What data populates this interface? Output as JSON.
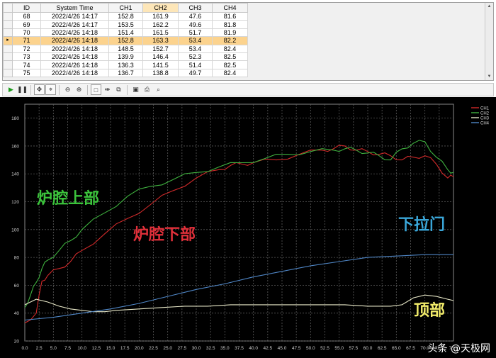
{
  "grid": {
    "columns": [
      "ID",
      "System Time",
      "CH1",
      "CH2",
      "CH3",
      "CH4"
    ],
    "active_column": "CH2",
    "rows": [
      {
        "id": "68",
        "time": "2022/4/26 14:17",
        "ch1": "152.8",
        "ch2": "161.9",
        "ch3": "47.6",
        "ch4": "81.6",
        "selected": false
      },
      {
        "id": "69",
        "time": "2022/4/26 14:17",
        "ch1": "153.5",
        "ch2": "162.2",
        "ch3": "49.6",
        "ch4": "81.8",
        "selected": false
      },
      {
        "id": "70",
        "time": "2022/4/26 14:18",
        "ch1": "151.4",
        "ch2": "161.5",
        "ch3": "51.7",
        "ch4": "81.9",
        "selected": false
      },
      {
        "id": "71",
        "time": "2022/4/26 14:18",
        "ch1": "152.8",
        "ch2": "163.3",
        "ch3": "53.4",
        "ch4": "82.2",
        "selected": true
      },
      {
        "id": "72",
        "time": "2022/4/26 14:18",
        "ch1": "148.5",
        "ch2": "152.7",
        "ch3": "53.4",
        "ch4": "82.4",
        "selected": false
      },
      {
        "id": "73",
        "time": "2022/4/26 14:18",
        "ch1": "139.9",
        "ch2": "146.4",
        "ch3": "52.3",
        "ch4": "82.5",
        "selected": false
      },
      {
        "id": "74",
        "time": "2022/4/26 14:18",
        "ch1": "136.3",
        "ch2": "141.5",
        "ch3": "51.4",
        "ch4": "82.5",
        "selected": false
      },
      {
        "id": "75",
        "time": "2022/4/26 14:18",
        "ch1": "136.7",
        "ch2": "138.8",
        "ch3": "49.7",
        "ch4": "82.4",
        "selected": false
      }
    ]
  },
  "toolbar": {
    "buttons": [
      {
        "name": "play-icon",
        "glyph": "▶"
      },
      {
        "name": "pause-icon",
        "glyph": "❚❚"
      },
      {
        "name": "pan-icon",
        "glyph": "✥"
      },
      {
        "name": "crosshair-zoom-icon",
        "glyph": "⌖"
      },
      {
        "name": "zoom-out-icon",
        "glyph": "⊖"
      },
      {
        "name": "zoom-in-icon",
        "glyph": "⊕"
      },
      {
        "name": "select-rect-icon",
        "glyph": "□"
      },
      {
        "name": "fit-icon",
        "glyph": "⇹"
      },
      {
        "name": "copy-icon",
        "glyph": "⧉"
      },
      {
        "name": "save-icon",
        "glyph": "▣"
      },
      {
        "name": "print-icon",
        "glyph": "⎙"
      },
      {
        "name": "preview-icon",
        "glyph": "⌕"
      }
    ]
  },
  "colors": {
    "ch1": "#d02a2a",
    "ch2": "#3fb13f",
    "ch3": "#e8e8c8",
    "ch4": "#4f86c6",
    "label_upper": "#3cc43c",
    "label_lower": "#e0303a",
    "label_door": "#3aa6d8",
    "label_top": "#f2ec6a"
  },
  "annotations": {
    "upper": "炉腔上部",
    "lower": "炉腔下部",
    "door": "下拉门",
    "top": "顶部"
  },
  "watermark": "头条 @天极网",
  "chart_data": {
    "type": "line",
    "xlim": [
      0,
      75
    ],
    "ylim": [
      20,
      190
    ],
    "x_ticks": [
      "0.0",
      "2.5",
      "5.0",
      "7.5",
      "10.0",
      "12.5",
      "15.0",
      "17.5",
      "20.0",
      "22.5",
      "25.0",
      "27.5",
      "30.0",
      "32.5",
      "35.0",
      "37.5",
      "40.0",
      "42.5",
      "45.0",
      "47.5",
      "50.0",
      "52.5",
      "55.0",
      "57.5",
      "60.0",
      "62.5",
      "65.0",
      "67.5",
      "70.0",
      "72.5",
      "75.0"
    ],
    "y_ticks": [
      "20",
      "40",
      "60",
      "80",
      "100",
      "120",
      "140",
      "160",
      "180"
    ],
    "grid": true,
    "legend_position": "top-right",
    "series": [
      {
        "name": "CH1",
        "x": [
          0,
          2,
          3,
          4,
          6,
          8,
          10,
          14,
          18,
          22,
          26,
          30,
          34,
          36,
          38,
          40,
          44,
          48,
          52,
          54,
          56,
          58,
          60,
          62,
          64,
          66,
          68,
          70,
          72,
          74,
          75
        ],
        "y": [
          33,
          40,
          63,
          67,
          72,
          77,
          85,
          97,
          108,
          118,
          128,
          137,
          143,
          146,
          147,
          148,
          150,
          154,
          157,
          158,
          160,
          157,
          156,
          154,
          153,
          150,
          152,
          153,
          147,
          137,
          138
        ]
      },
      {
        "name": "CH2",
        "x": [
          0,
          1,
          2,
          3,
          4,
          6,
          8,
          10,
          14,
          18,
          22,
          26,
          30,
          34,
          38,
          42,
          46,
          50,
          54,
          56,
          58,
          60,
          62,
          64,
          66,
          68,
          70,
          72,
          74,
          75
        ],
        "y": [
          44,
          53,
          62,
          72,
          78,
          85,
          92,
          100,
          112,
          124,
          131,
          136,
          141,
          145,
          148,
          151,
          154,
          156,
          157,
          158,
          157,
          155,
          153,
          150,
          158,
          162,
          163,
          152,
          143,
          141
        ]
      },
      {
        "name": "CH3",
        "x": [
          0,
          2,
          4,
          6,
          8,
          10,
          12,
          14,
          16,
          20,
          24,
          28,
          32,
          36,
          40,
          44,
          48,
          52,
          56,
          60,
          64,
          66,
          68,
          70,
          72,
          74,
          75
        ],
        "y": [
          46,
          50,
          48,
          45,
          43,
          42,
          41,
          41,
          42,
          43,
          44,
          45,
          45,
          46,
          46,
          46,
          46,
          46,
          46,
          45,
          45,
          46,
          51,
          53,
          52,
          50,
          49
        ]
      },
      {
        "name": "CH4",
        "x": [
          0,
          5,
          10,
          15,
          20,
          25,
          30,
          35,
          40,
          45,
          50,
          55,
          60,
          65,
          70,
          75
        ],
        "y": [
          35,
          37,
          40,
          43,
          47,
          52,
          57,
          61,
          66,
          70,
          74,
          77,
          80,
          81,
          82,
          82
        ]
      }
    ]
  }
}
